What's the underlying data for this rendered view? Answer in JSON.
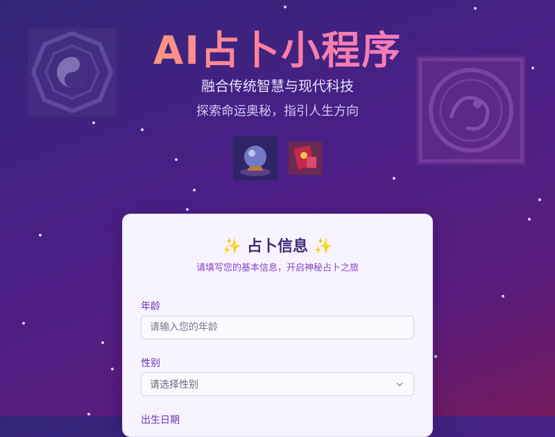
{
  "header": {
    "title": "AI占卜小程序",
    "subtitle": "融合传统智慧与现代科技",
    "tagline": "探索命运奥秘，指引人生方向"
  },
  "decor": {
    "images": [
      "bagua-image",
      "dragon-image",
      "crystal-ball-image",
      "red-envelope-image"
    ]
  },
  "card": {
    "title": "占卜信息",
    "sparkle_icon": "sparkles-icon",
    "subtitle": "请填写您的基本信息，开启神秘占卜之旅",
    "fields": {
      "age": {
        "label": "年龄",
        "placeholder": "请输入您的年龄"
      },
      "gender": {
        "label": "性别",
        "placeholder": "请选择性别"
      },
      "birthdate": {
        "label": "出生日期"
      }
    }
  },
  "colors": {
    "accent": "#6a2fb1",
    "title_gradient_start": "#ffb05a",
    "title_gradient_end": "#e07be0",
    "spark": "#f0b52b"
  }
}
